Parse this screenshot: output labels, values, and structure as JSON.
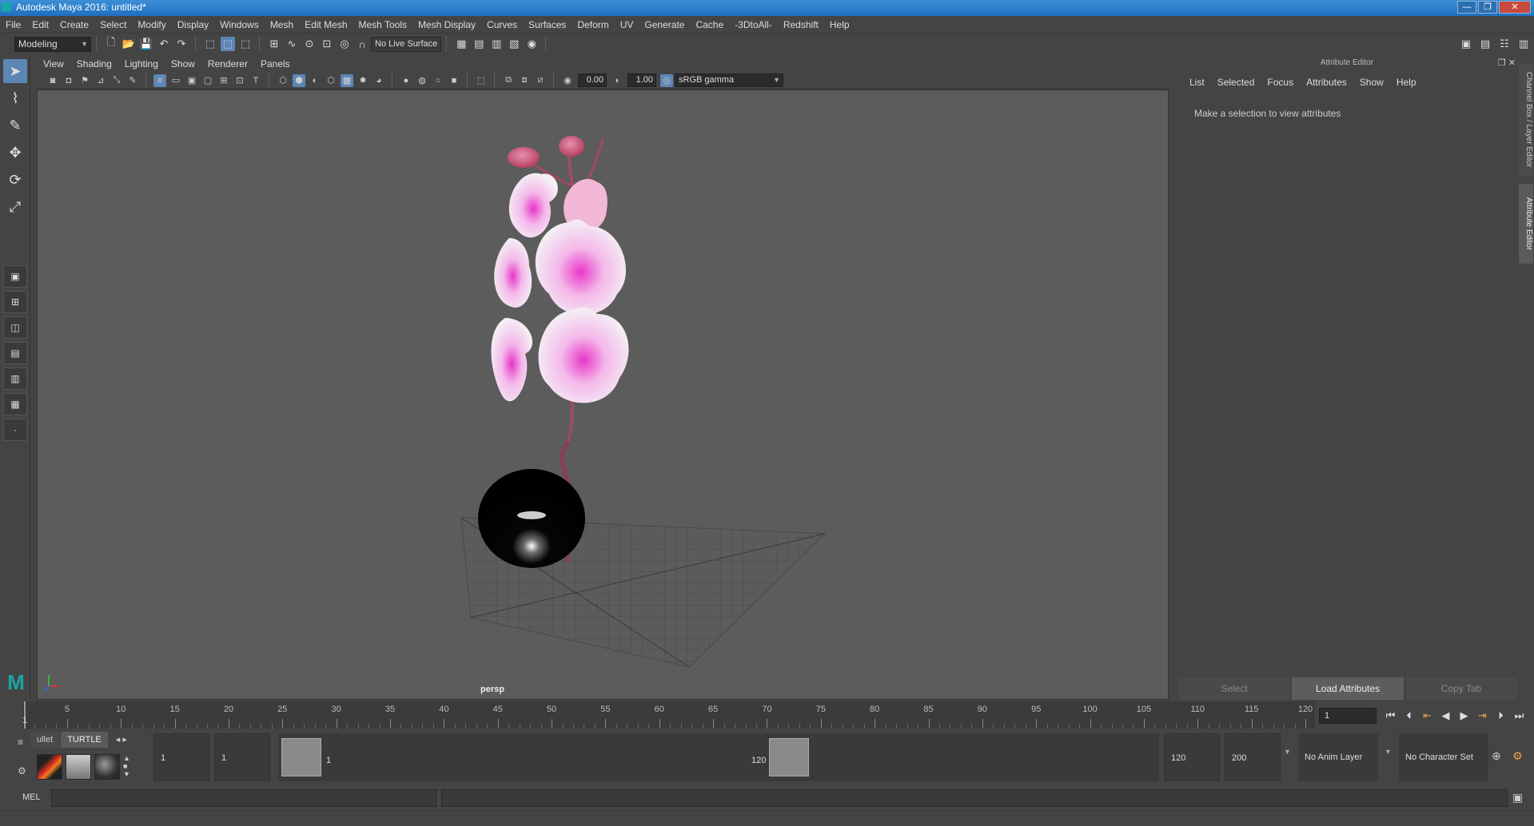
{
  "window": {
    "title": "Autodesk Maya 2016: untitled*",
    "minimize": "—",
    "restore": "❐",
    "close": "✕"
  },
  "menubar": [
    "File",
    "Edit",
    "Create",
    "Select",
    "Modify",
    "Display",
    "Windows",
    "Mesh",
    "Edit Mesh",
    "Mesh Tools",
    "Mesh Display",
    "Curves",
    "Surfaces",
    "Deform",
    "UV",
    "Generate",
    "Cache",
    "-3DtoAll-",
    "Redshift",
    "Help"
  ],
  "statusline": {
    "menu_set": "Modeling",
    "live_surface": "No Live Surface"
  },
  "panel": {
    "menus": [
      "View",
      "Shading",
      "Lighting",
      "Show",
      "Renderer",
      "Panels"
    ],
    "exposure": "0.00",
    "gamma": "1.00",
    "color_space": "sRGB gamma",
    "camera": "persp"
  },
  "attribute_editor": {
    "title": "Attribute Editor",
    "menus": [
      "List",
      "Selected",
      "Focus",
      "Attributes",
      "Show",
      "Help"
    ],
    "message": "Make a selection to view attributes",
    "buttons": {
      "select": "Select",
      "load": "Load Attributes",
      "copy": "Copy Tab"
    }
  },
  "side_tabs": {
    "channel_box": "Channel Box / Layer Editor",
    "attribute_editor": "Attribute Editor"
  },
  "timeline": {
    "ticks": [
      5,
      10,
      15,
      20,
      25,
      30,
      35,
      40,
      45,
      50,
      55,
      60,
      65,
      70,
      75,
      80,
      85,
      90,
      95,
      100,
      105,
      110,
      115,
      120
    ],
    "current_frame_label": "1",
    "current_frame": "1"
  },
  "shelf": {
    "tabs": [
      "ullet",
      "TURTLE"
    ],
    "active_tab": "TURTLE",
    "arrows": "◂ ▸"
  },
  "range": {
    "start": "1",
    "playback_start": "1",
    "range_start_label": "1",
    "range_end_label": "120",
    "playback_end": "120",
    "end": "200",
    "anim_layer": "No Anim Layer",
    "character_set": "No Character Set"
  },
  "cmdline": {
    "label": "MEL"
  },
  "colors": {
    "accent": "#5e86b5",
    "viewport_bg": "#5c5c5c",
    "title_bar": "#2a7bcb"
  }
}
